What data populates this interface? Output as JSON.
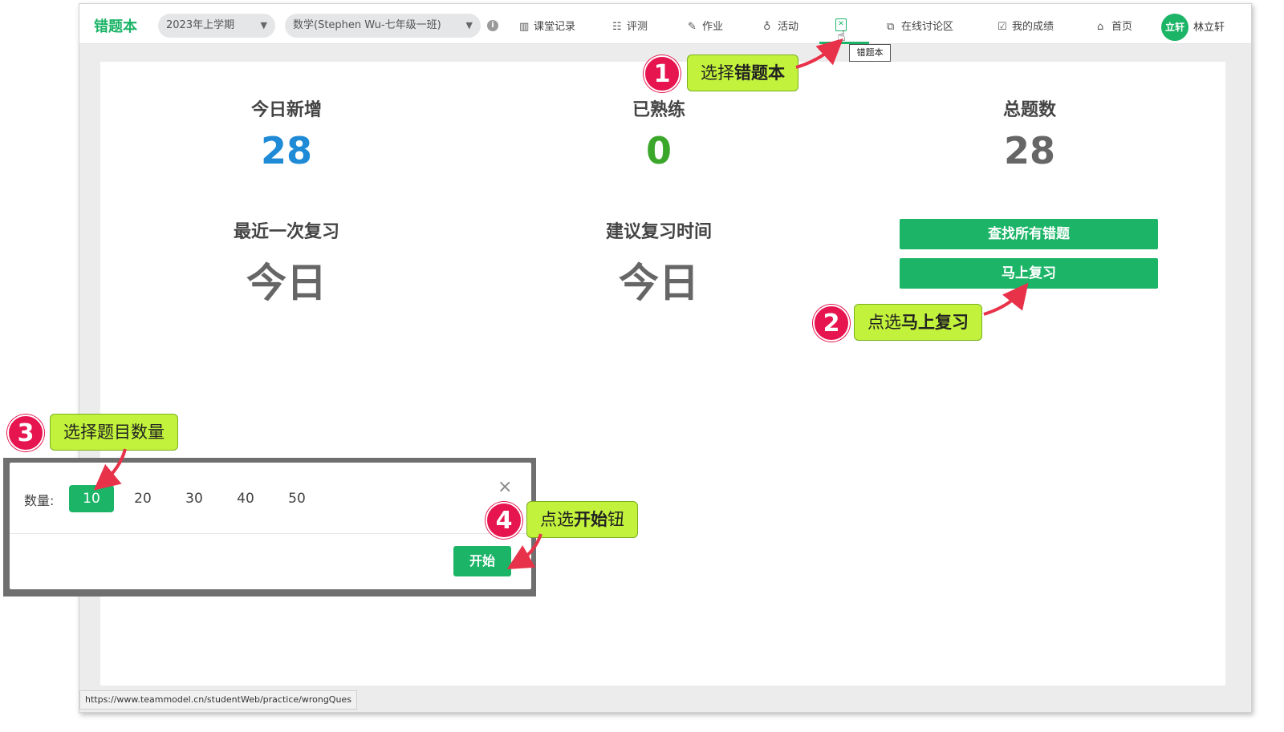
{
  "topbar": {
    "brand": "错题本",
    "semester_select": "2023年上学期",
    "class_select": "数学(Stephen Wu-七年级一班)",
    "nav": [
      {
        "icon": "books-icon",
        "label": "课堂记录"
      },
      {
        "icon": "checklist-icon",
        "label": "评测"
      },
      {
        "icon": "homework-icon",
        "label": "作业"
      },
      {
        "icon": "lightbulb-icon",
        "label": "活动"
      },
      {
        "icon": "chat-icon",
        "label": "在线讨论区"
      },
      {
        "icon": "grade-icon",
        "label": "我的成绩"
      },
      {
        "icon": "home-icon",
        "label": "首页"
      }
    ],
    "active_tooltip": "错题本",
    "avatar_text": "立轩",
    "username": "林立轩"
  },
  "stats": {
    "today_new": {
      "label": "今日新增",
      "value": "28"
    },
    "mastered": {
      "label": "已熟练",
      "value": "0"
    },
    "total": {
      "label": "总题数",
      "value": "28"
    },
    "last_review": {
      "label": "最近一次复习",
      "value": "今日"
    },
    "suggested_review": {
      "label": "建议复习时间",
      "value": "今日"
    }
  },
  "buttons": {
    "find_all": "查找所有错题",
    "review_now": "马上复习"
  },
  "dialog": {
    "label": "数量:",
    "options": [
      "10",
      "20",
      "30",
      "40",
      "50"
    ],
    "selected": "10",
    "close_glyph": "×",
    "start": "开始"
  },
  "status_url": "https://www.teammodel.cn/studentWeb/practice/wrongQues",
  "annotations": {
    "step1": {
      "num": "1",
      "text": "选择",
      "bold": "错题本"
    },
    "step2": {
      "num": "2",
      "text": "点选",
      "bold": "马上复习"
    },
    "step3": {
      "num": "3",
      "text": "选择题目数量"
    },
    "step4": {
      "num": "4",
      "text": "点选",
      "bold": "开始",
      "suffix": "钮"
    }
  },
  "colors": {
    "brand_green": "#1cb467",
    "today_new_blue": "#1f8ad6",
    "mastered_green": "#3aa72a",
    "badge_red": "#e6144f",
    "callout_lime": "#c2f23c",
    "arrow_red": "#e8324a"
  }
}
